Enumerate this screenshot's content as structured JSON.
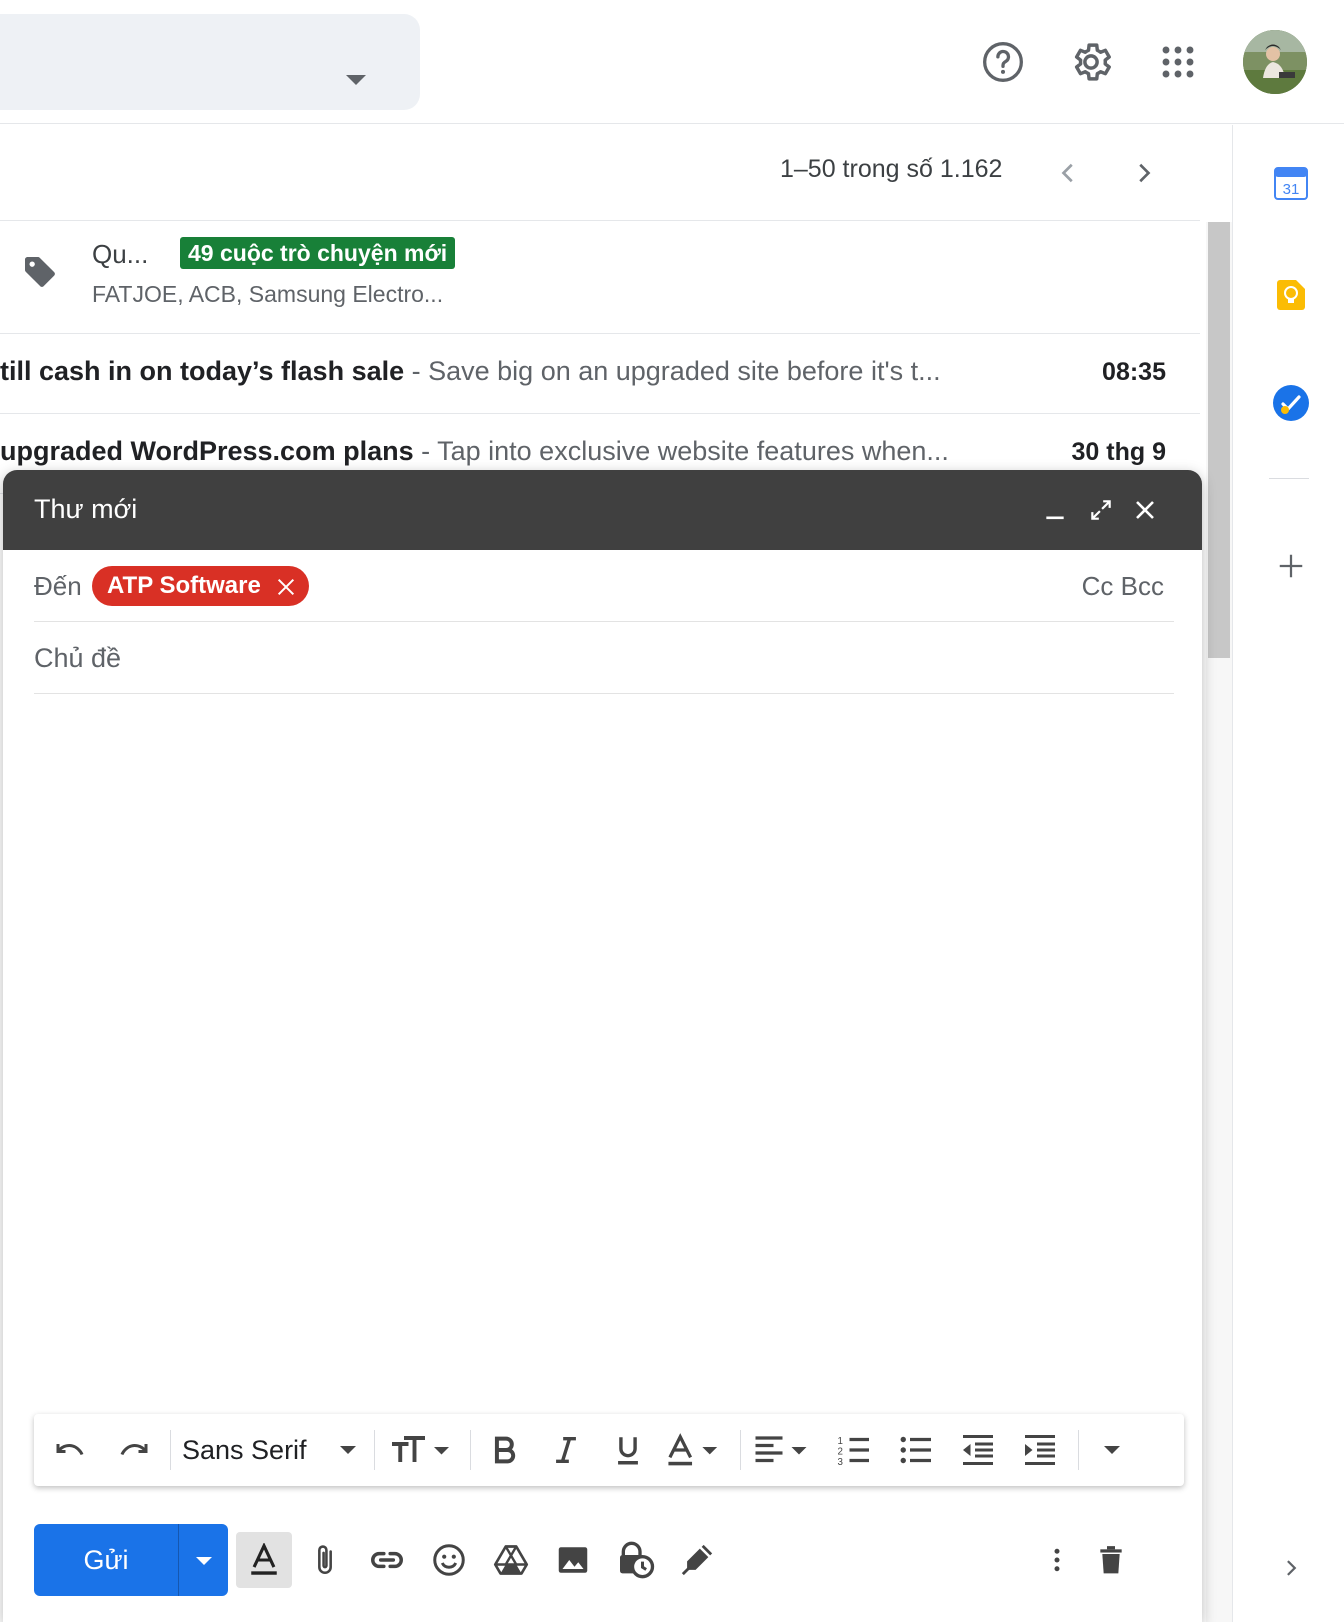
{
  "header": {
    "help_icon": "help-icon",
    "settings_icon": "gear-icon",
    "apps_icon": "apps-grid-icon"
  },
  "toolbar": {
    "page_count": "1–50 trong số 1.162"
  },
  "category_row": {
    "name": "Qu...",
    "badge": "49 cuộc trò chuyện mới",
    "senders": "FATJOE, ACB, Samsung Electro...",
    "badge_color": "#188038"
  },
  "emails": [
    {
      "subject": "till cash in on today’s flash sale",
      "snippet": " - Save big on an upgraded site before it's t...",
      "time": "08:35"
    },
    {
      "subject": "upgraded WordPress.com plans",
      "snippet": " - Tap into exclusive website features when...",
      "time": "30 thg 9"
    }
  ],
  "side_panel": {
    "calendar_day": "31"
  },
  "compose": {
    "title": "Thư mới",
    "to_label": "Đến",
    "recipient": "ATP Software",
    "cc_bcc": "Cc Bcc",
    "subject_placeholder": "Chủ đề",
    "font": "Sans Serif",
    "send_label": "Gửi",
    "send_color": "#1a73e8",
    "chip_color": "#d93025"
  }
}
